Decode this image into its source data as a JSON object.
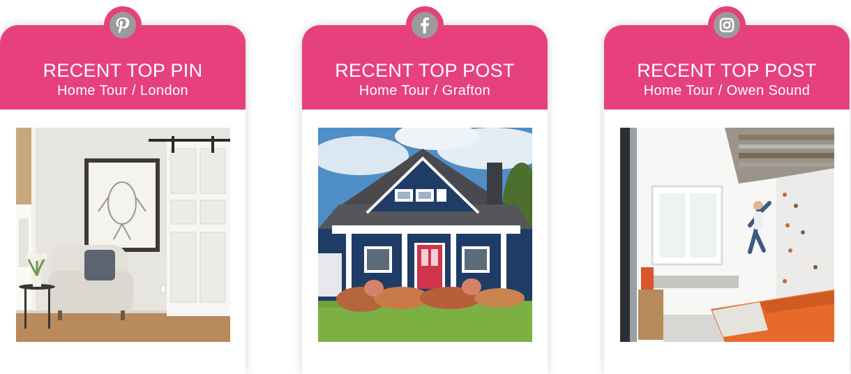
{
  "colors": {
    "accent": "#e6417d",
    "icon_gray": "#9b9b9b"
  },
  "cards": [
    {
      "network_icon": "pinterest-icon",
      "title": "RECENT TOP PIN",
      "subtitle": "Home Tour / London",
      "photo": "sitting-room-with-armchair-and-botanical-print"
    },
    {
      "network_icon": "facebook-icon",
      "title": "RECENT TOP POST",
      "subtitle": "Home Tour / Grafton",
      "photo": "blue-house-exterior-with-red-door"
    },
    {
      "network_icon": "instagram-icon",
      "title": "RECENT TOP POST",
      "subtitle": "Home Tour / Owen Sound",
      "photo": "kids-bedroom-with-climbing-wall"
    }
  ]
}
